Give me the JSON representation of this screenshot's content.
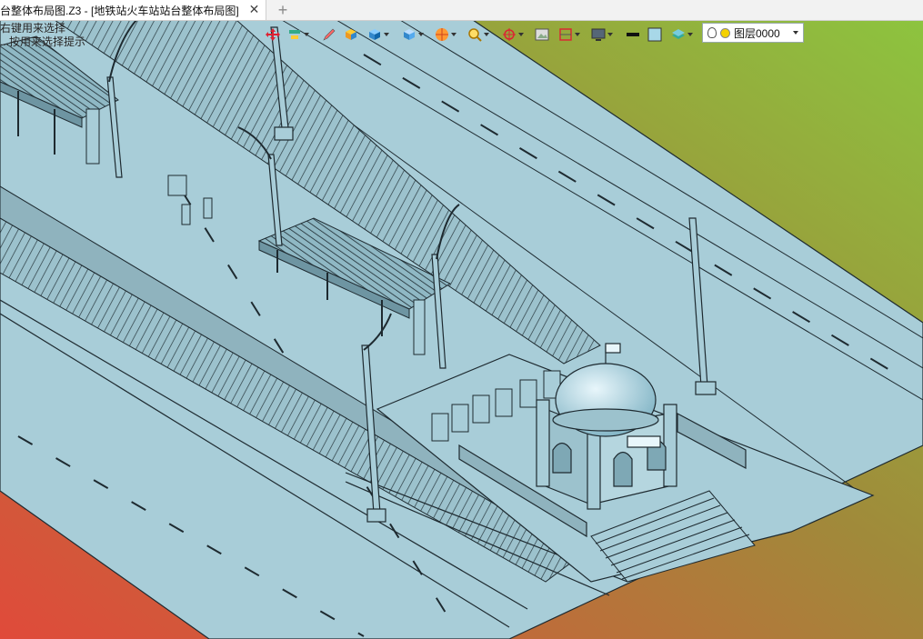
{
  "window": {
    "tab_title": "台整体布局图.Z3 - [地铁站火车站站台整体布局图]",
    "close_glyph": "✕",
    "add_glyph": "+"
  },
  "hint": {
    "line1": "右键用来选择",
    "line2": "...按用来选择提示"
  },
  "toolbar": {
    "icons": [
      "move-icon",
      "align-icon",
      "pencil-icon",
      "box-icon",
      "cube-view-icon",
      "cube-shaded-icon",
      "render-icon",
      "zoom-icon",
      "snap-icon",
      "image-icon",
      "measure-icon",
      "display-icon",
      "line-style-icon",
      "color-swatch-icon",
      "layers-icon"
    ]
  },
  "layer": {
    "name": "图层0000"
  },
  "colors": {
    "model": "#a8cdd8",
    "edge": "#1e2a30",
    "bg_top_right": "#8cc63f",
    "bg_bottom_left": "#e04a3a"
  }
}
